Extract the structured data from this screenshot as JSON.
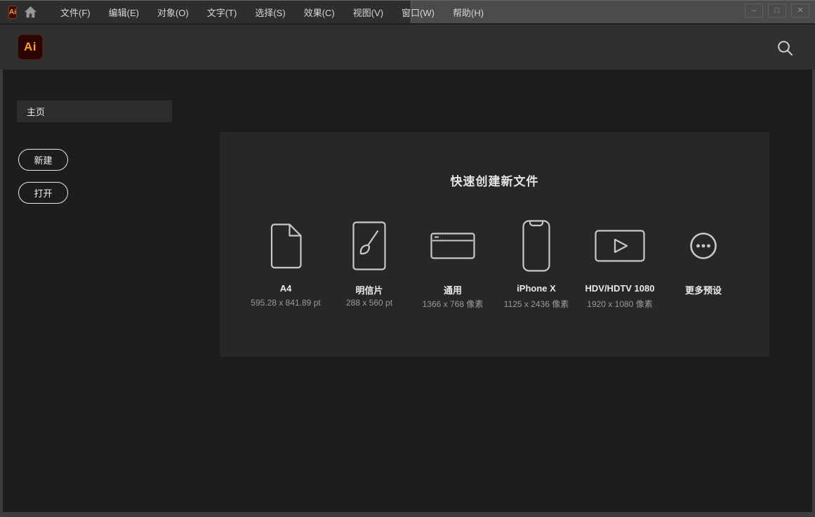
{
  "titlebar": {
    "app_badge": "Ai",
    "menus": [
      "文件(F)",
      "编辑(E)",
      "对象(O)",
      "文字(T)",
      "选择(S)",
      "效果(C)",
      "视图(V)",
      "窗口(W)",
      "帮助(H)"
    ],
    "window_controls": {
      "minimize": "–",
      "maximize": "□",
      "close": "✕"
    }
  },
  "header": {
    "logo_text": "Ai"
  },
  "sidebar": {
    "home_label": "主页",
    "new_button": "新建",
    "open_button": "打开"
  },
  "main": {
    "quick_start": {
      "title": "快速创建新文件",
      "presets": [
        {
          "name": "A4",
          "dims": "595.28 x 841.89 pt",
          "icon": "document-icon"
        },
        {
          "name": "明信片",
          "dims": "288 x 560 pt",
          "icon": "postcard-brush-icon"
        },
        {
          "name": "通用",
          "dims": "1366 x 768 像素",
          "icon": "browser-window-icon"
        },
        {
          "name": "iPhone X",
          "dims": "1125 x 2436 像素",
          "icon": "phone-icon"
        },
        {
          "name": "HDV/HDTV 1080",
          "dims": "1920 x 1080 像素",
          "icon": "video-play-icon"
        },
        {
          "name": "更多预设",
          "dims": "",
          "icon": "ellipsis-circle-icon"
        }
      ]
    }
  },
  "colors": {
    "titlebar_light": "#4b4b4b",
    "titlebar_dark": "#2e2e2e",
    "appbar": "#303030",
    "content_bg": "#1d1d1d",
    "panel_bg": "#272727",
    "frame_border": "#3d3d3d",
    "accent_orange": "#ff9e2c",
    "logo_maroon": "#2b0502",
    "icon_stroke": "#c8c8c8",
    "text_primary": "#eaeaea",
    "text_secondary": "#9b9b9b"
  }
}
